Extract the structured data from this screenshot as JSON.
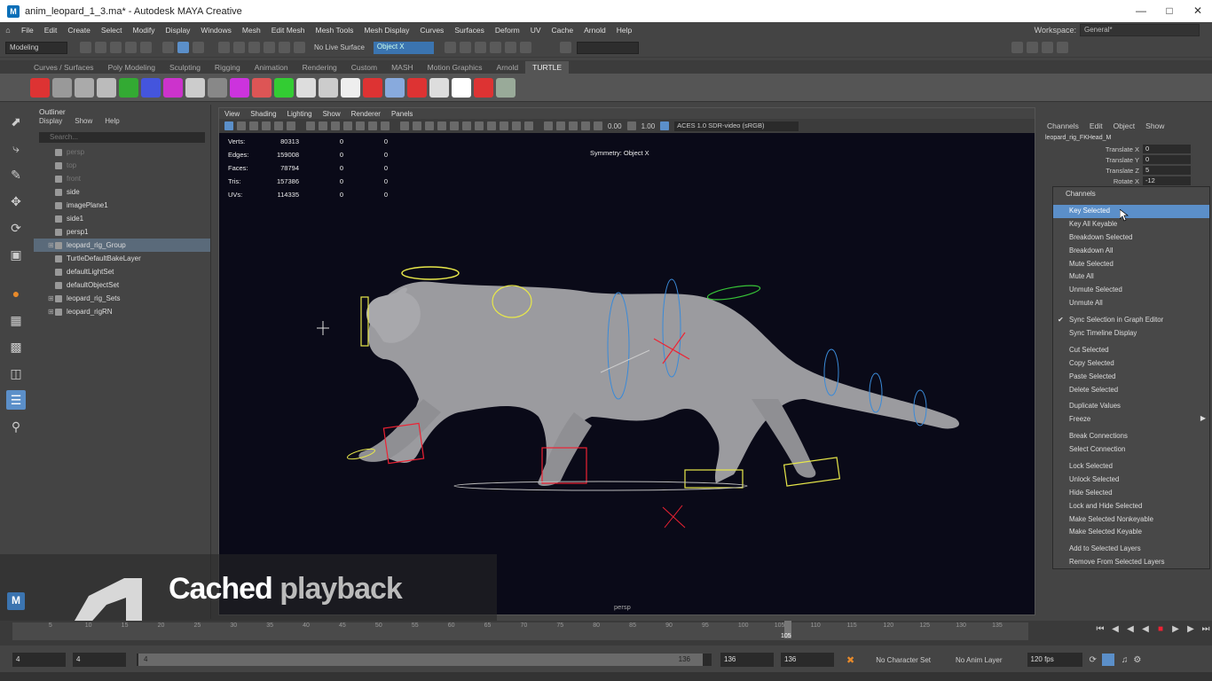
{
  "window": {
    "title": "anim_leopard_1_3.ma* - Autodesk MAYA Creative",
    "logo": "M"
  },
  "menubar": {
    "items": [
      "File",
      "Edit",
      "Create",
      "Select",
      "Modify",
      "Display",
      "Windows",
      "Mesh",
      "Edit Mesh",
      "Mesh Tools",
      "Mesh Display",
      "Curves",
      "Surfaces",
      "Deform",
      "UV",
      "Cache",
      "Arnold",
      "Help"
    ],
    "workspace_label": "Workspace:",
    "workspace_value": "General*"
  },
  "statusline": {
    "mode": "Modeling",
    "live_surface": "No Live Surface",
    "symmetry": "Object X"
  },
  "shelf": {
    "tabs": [
      "Curves / Surfaces",
      "Poly Modeling",
      "Sculpting",
      "Rigging",
      "Animation",
      "Rendering",
      "Custom",
      "MASH",
      "Motion Graphics",
      "Arnold",
      "TURTLE"
    ],
    "active_tab": "TURTLE",
    "icons": [
      "#d33",
      "#999",
      "#aaa",
      "#bbb",
      "#3a3",
      "#45d",
      "#c3c",
      "#ccc",
      "#888",
      "#c3d",
      "#d55",
      "#3c3",
      "#ddd",
      "#ccc",
      "#eee",
      "#d33",
      "#8ad",
      "#d33",
      "#ddd",
      "#fff",
      "#d33",
      "#9a9"
    ]
  },
  "outliner": {
    "title": "Outliner",
    "menu": [
      "Display",
      "Show",
      "Help"
    ],
    "search_placeholder": "Search...",
    "items": [
      {
        "label": "persp",
        "dim": true
      },
      {
        "label": "top",
        "dim": true
      },
      {
        "label": "front",
        "dim": true
      },
      {
        "label": "side",
        "dim": false
      },
      {
        "label": "imagePlane1",
        "dim": false
      },
      {
        "label": "side1",
        "dim": false
      },
      {
        "label": "persp1",
        "dim": false
      },
      {
        "label": "leopard_rig_Group",
        "dim": false,
        "selected": true,
        "expandable": true
      },
      {
        "label": "TurtleDefaultBakeLayer",
        "dim": false
      },
      {
        "label": "defaultLightSet",
        "dim": false
      },
      {
        "label": "defaultObjectSet",
        "dim": false
      },
      {
        "label": "leopard_rig_Sets",
        "dim": false,
        "expandable": true
      },
      {
        "label": "leopard_rigRN",
        "dim": false,
        "expandable": true
      }
    ]
  },
  "viewport": {
    "menu": [
      "View",
      "Shading",
      "Lighting",
      "Show",
      "Renderer",
      "Panels"
    ],
    "exposure": "0.00",
    "gamma": "1.00",
    "colorspace": "ACES 1.0 SDR-video (sRGB)",
    "hud": [
      {
        "label": "Verts:",
        "v": "80313",
        "a": "0",
        "b": "0"
      },
      {
        "label": "Edges:",
        "v": "159008",
        "a": "0",
        "b": "0"
      },
      {
        "label": "Faces:",
        "v": "78794",
        "a": "0",
        "b": "0"
      },
      {
        "label": "Tris:",
        "v": "157386",
        "a": "0",
        "b": "0"
      },
      {
        "label": "UVs:",
        "v": "114335",
        "a": "0",
        "b": "0"
      }
    ],
    "symmetry": "Symmetry: Object X",
    "camera": "persp"
  },
  "caption": {
    "word1": "Cached",
    "word2": "playback"
  },
  "channelbox": {
    "menu": [
      "Channels",
      "Edit",
      "Object",
      "Show"
    ],
    "object": "leopard_rig_FKHead_M",
    "attrs": [
      {
        "name": "Translate X",
        "value": "0"
      },
      {
        "name": "Translate Y",
        "value": "0"
      },
      {
        "name": "Translate Z",
        "value": "5"
      },
      {
        "name": "Rotate X",
        "value": "-12"
      }
    ]
  },
  "contextmenu": {
    "title": "Channels",
    "groups": [
      [
        {
          "label": "Key Selected",
          "hl": true
        },
        {
          "label": "Key All Keyable"
        },
        {
          "label": "Breakdown Selected"
        },
        {
          "label": "Breakdown All"
        },
        {
          "label": "Mute Selected"
        },
        {
          "label": "Mute All"
        },
        {
          "label": "Unmute Selected"
        },
        {
          "label": "Unmute All"
        }
      ],
      [
        {
          "label": "Sync Selection in Graph Editor",
          "checked": true
        },
        {
          "label": "Sync Timeline Display"
        }
      ],
      [
        {
          "label": "Cut Selected"
        },
        {
          "label": "Copy Selected"
        },
        {
          "label": "Paste Selected"
        },
        {
          "label": "Delete Selected"
        }
      ],
      [
        {
          "label": "Duplicate Values"
        },
        {
          "label": "Freeze",
          "submenu": true
        }
      ],
      [
        {
          "label": "Break Connections"
        },
        {
          "label": "Select Connection"
        }
      ],
      [
        {
          "label": "Lock Selected"
        },
        {
          "label": "Unlock Selected"
        },
        {
          "label": "Hide Selected"
        },
        {
          "label": "Lock and Hide Selected"
        },
        {
          "label": "Make Selected Nonkeyable"
        },
        {
          "label": "Make Selected Keyable"
        }
      ],
      [
        {
          "label": "Add to Selected Layers"
        },
        {
          "label": "Remove From Selected Layers"
        }
      ]
    ]
  },
  "timeline": {
    "ticks": [
      "5",
      "10",
      "15",
      "20",
      "25",
      "30",
      "35",
      "40",
      "45",
      "50",
      "55",
      "60",
      "65",
      "70",
      "75",
      "80",
      "85",
      "90",
      "95",
      "100",
      "105",
      "110",
      "115",
      "120",
      "125",
      "130",
      "135"
    ],
    "current": "105",
    "start": "4",
    "range_start": "4",
    "range_slider": "4",
    "range_end": "136",
    "end": "136",
    "end2": "136",
    "character_set": "No Character Set",
    "anim_layer": "No Anim Layer",
    "fps": "120 fps"
  }
}
